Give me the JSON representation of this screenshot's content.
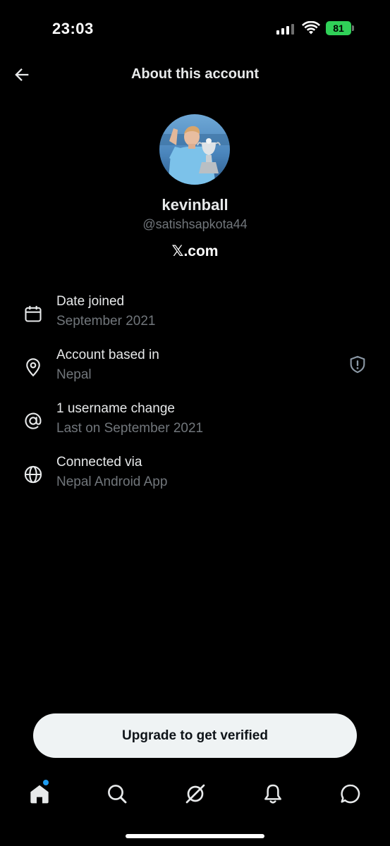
{
  "status_bar": {
    "time": "23:03",
    "battery": "81"
  },
  "header": {
    "title": "About this account",
    "back_icon": "arrow-left-icon"
  },
  "profile": {
    "display_name": "kevinball",
    "handle": "@satishsapkota44",
    "source": "𝕏.com"
  },
  "details": [
    {
      "icon": "calendar-icon",
      "label": "Date joined",
      "value": "September 2021"
    },
    {
      "icon": "location-pin-icon",
      "label": "Account based in",
      "value": "Nepal"
    },
    {
      "icon": "at-sign-icon",
      "label": "1 username change",
      "value": "Last on September 2021"
    },
    {
      "icon": "globe-icon",
      "label": "Connected via",
      "value": "Nepal Android App"
    }
  ],
  "upgrade_button": {
    "label": "Upgrade to get verified"
  },
  "tab_bar": [
    "home-icon",
    "search-icon",
    "grok-icon",
    "bell-icon",
    "messages-icon"
  ],
  "colors": {
    "background": "#000000",
    "primary_text": "#e7e9ea",
    "secondary_text": "#71767b",
    "accent": "#1d9bf0",
    "battery": "#30d158",
    "button_bg": "#eff3f4"
  }
}
